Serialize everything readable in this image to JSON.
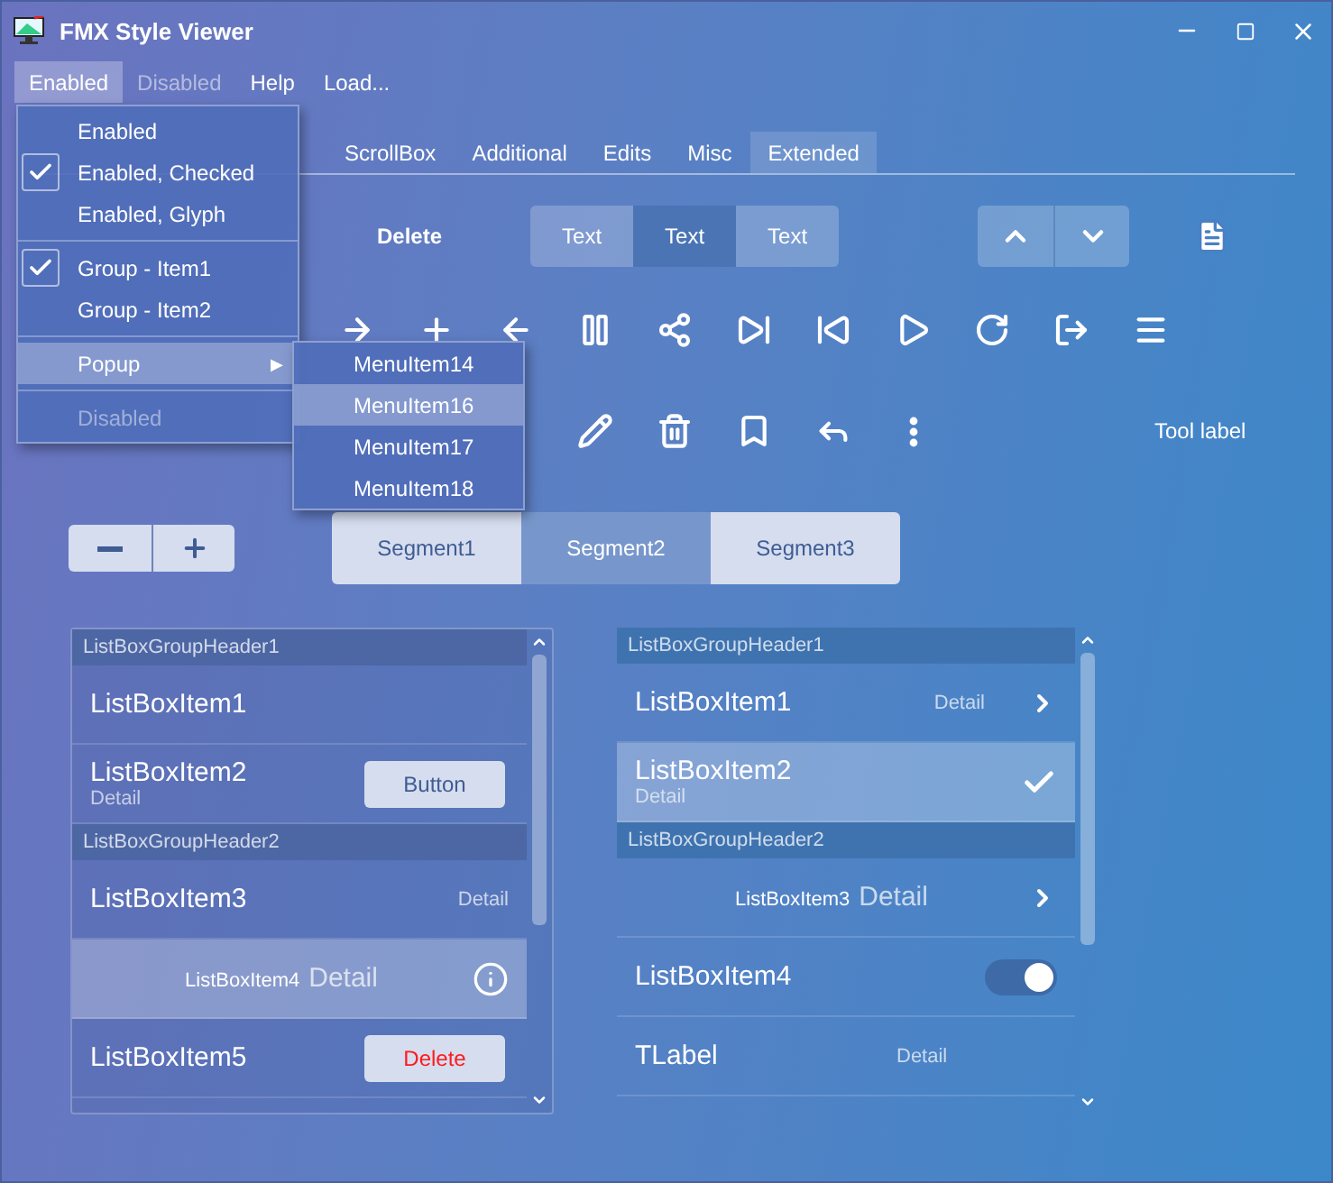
{
  "window": {
    "title": "FMX Style Viewer"
  },
  "menu_bar": [
    {
      "label": "Enabled",
      "selected": true,
      "disabled": false
    },
    {
      "label": "Disabled",
      "selected": false,
      "disabled": true
    },
    {
      "label": "Help",
      "selected": false,
      "disabled": false
    },
    {
      "label": "Load...",
      "selected": false,
      "disabled": false
    }
  ],
  "dropdown": [
    {
      "kind": "item",
      "label": "Enabled",
      "checked": false,
      "selected": false,
      "disabled": false
    },
    {
      "kind": "item",
      "label": "Enabled, Checked",
      "checked": true,
      "selected": false,
      "disabled": false
    },
    {
      "kind": "item",
      "label": "Enabled, Glyph",
      "checked": false,
      "selected": false,
      "disabled": false
    },
    {
      "kind": "separator"
    },
    {
      "kind": "item",
      "label": "Group - Item1",
      "checked": true,
      "selected": false,
      "disabled": false
    },
    {
      "kind": "item",
      "label": "Group - Item2",
      "checked": false,
      "selected": false,
      "disabled": false
    },
    {
      "kind": "separator"
    },
    {
      "kind": "submenu",
      "label": "Popup",
      "arrow": "▶",
      "checked": false,
      "selected": true,
      "disabled": false
    },
    {
      "kind": "separator"
    },
    {
      "kind": "item",
      "label": "Disabled",
      "checked": false,
      "selected": false,
      "disabled": true
    }
  ],
  "submenu": [
    {
      "label": "MenuItem14",
      "selected": false
    },
    {
      "label": "MenuItem16",
      "selected": true
    },
    {
      "label": "MenuItem17",
      "selected": false
    },
    {
      "label": "MenuItem18",
      "selected": false
    }
  ],
  "tabs": [
    {
      "label": "ScrollBox",
      "selected": false
    },
    {
      "label": "Additional",
      "selected": false
    },
    {
      "label": "Edits",
      "selected": false
    },
    {
      "label": "Misc",
      "selected": false
    },
    {
      "label": "Extended",
      "selected": true
    }
  ],
  "toolbar": {
    "delete_label": "Delete",
    "text_segments": [
      {
        "label": "Text",
        "selected": false
      },
      {
        "label": "Text",
        "selected": true
      },
      {
        "label": "Text",
        "selected": false
      }
    ],
    "tool_label": "Tool label"
  },
  "segments": [
    {
      "label": "Segment1",
      "selected": false
    },
    {
      "label": "Segment2",
      "selected": true
    },
    {
      "label": "Segment3",
      "selected": false
    }
  ],
  "list_left": [
    {
      "kind": "header",
      "title": "ListBoxGroupHeader1"
    },
    {
      "kind": "item",
      "title": "ListBoxItem1",
      "selected": false
    },
    {
      "kind": "item",
      "title": "ListBoxItem2",
      "subtitle": "Detail",
      "button": {
        "label": "Button",
        "danger": false
      },
      "selected": false
    },
    {
      "kind": "header",
      "title": "ListBoxGroupHeader2"
    },
    {
      "kind": "item",
      "title": "ListBoxItem3",
      "detail": "Detail",
      "selected": false
    },
    {
      "kind": "centered",
      "title": "ListBoxItem4",
      "detail": "Detail",
      "info_icon": true,
      "selected": true
    },
    {
      "kind": "item",
      "title": "ListBoxItem5",
      "button": {
        "label": "Delete",
        "danger": true
      },
      "selected": false
    }
  ],
  "list_right": [
    {
      "kind": "header",
      "title": "ListBoxGroupHeader1"
    },
    {
      "kind": "item",
      "title": "ListBoxItem1",
      "detail": "Detail",
      "chevron": true,
      "selected": false
    },
    {
      "kind": "item",
      "title": "ListBoxItem2",
      "subtitle": "Detail",
      "checkmark": true,
      "selected": true
    },
    {
      "kind": "header",
      "title": "ListBoxGroupHeader2"
    },
    {
      "kind": "centered",
      "title": "ListBoxItem3",
      "detail": "Detail",
      "chevron": true,
      "selected": false
    },
    {
      "kind": "switch",
      "title": "ListBoxItem4",
      "on": true,
      "selected": false
    },
    {
      "kind": "label",
      "title": "TLabel",
      "detail": "Detail",
      "selected": false
    }
  ]
}
